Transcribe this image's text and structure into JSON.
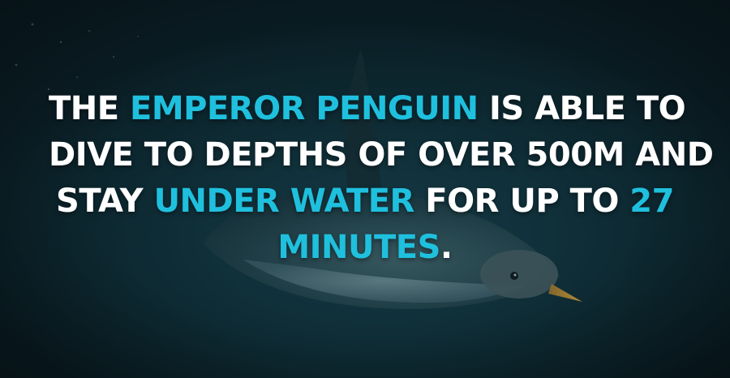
{
  "colors": {
    "text": "#ffffff",
    "highlight": "#1fc0de",
    "background": "#0f2a33"
  },
  "background_image": {
    "subject": "emperor-penguin-swimming-underwater"
  },
  "fact": {
    "line1": {
      "t1": "THE ",
      "h1": "EMPEROR PENGUIN",
      "t2": " IS ABLE TO"
    },
    "line2": {
      "t1": "DIVE TO DEPTHS OF OVER 500M AND"
    },
    "line3": {
      "t1": "STAY ",
      "h1": "UNDER WATER",
      "t2": " FOR UP TO ",
      "h2": "27"
    },
    "line4": {
      "h1": "MINUTES",
      "t1": "."
    }
  }
}
